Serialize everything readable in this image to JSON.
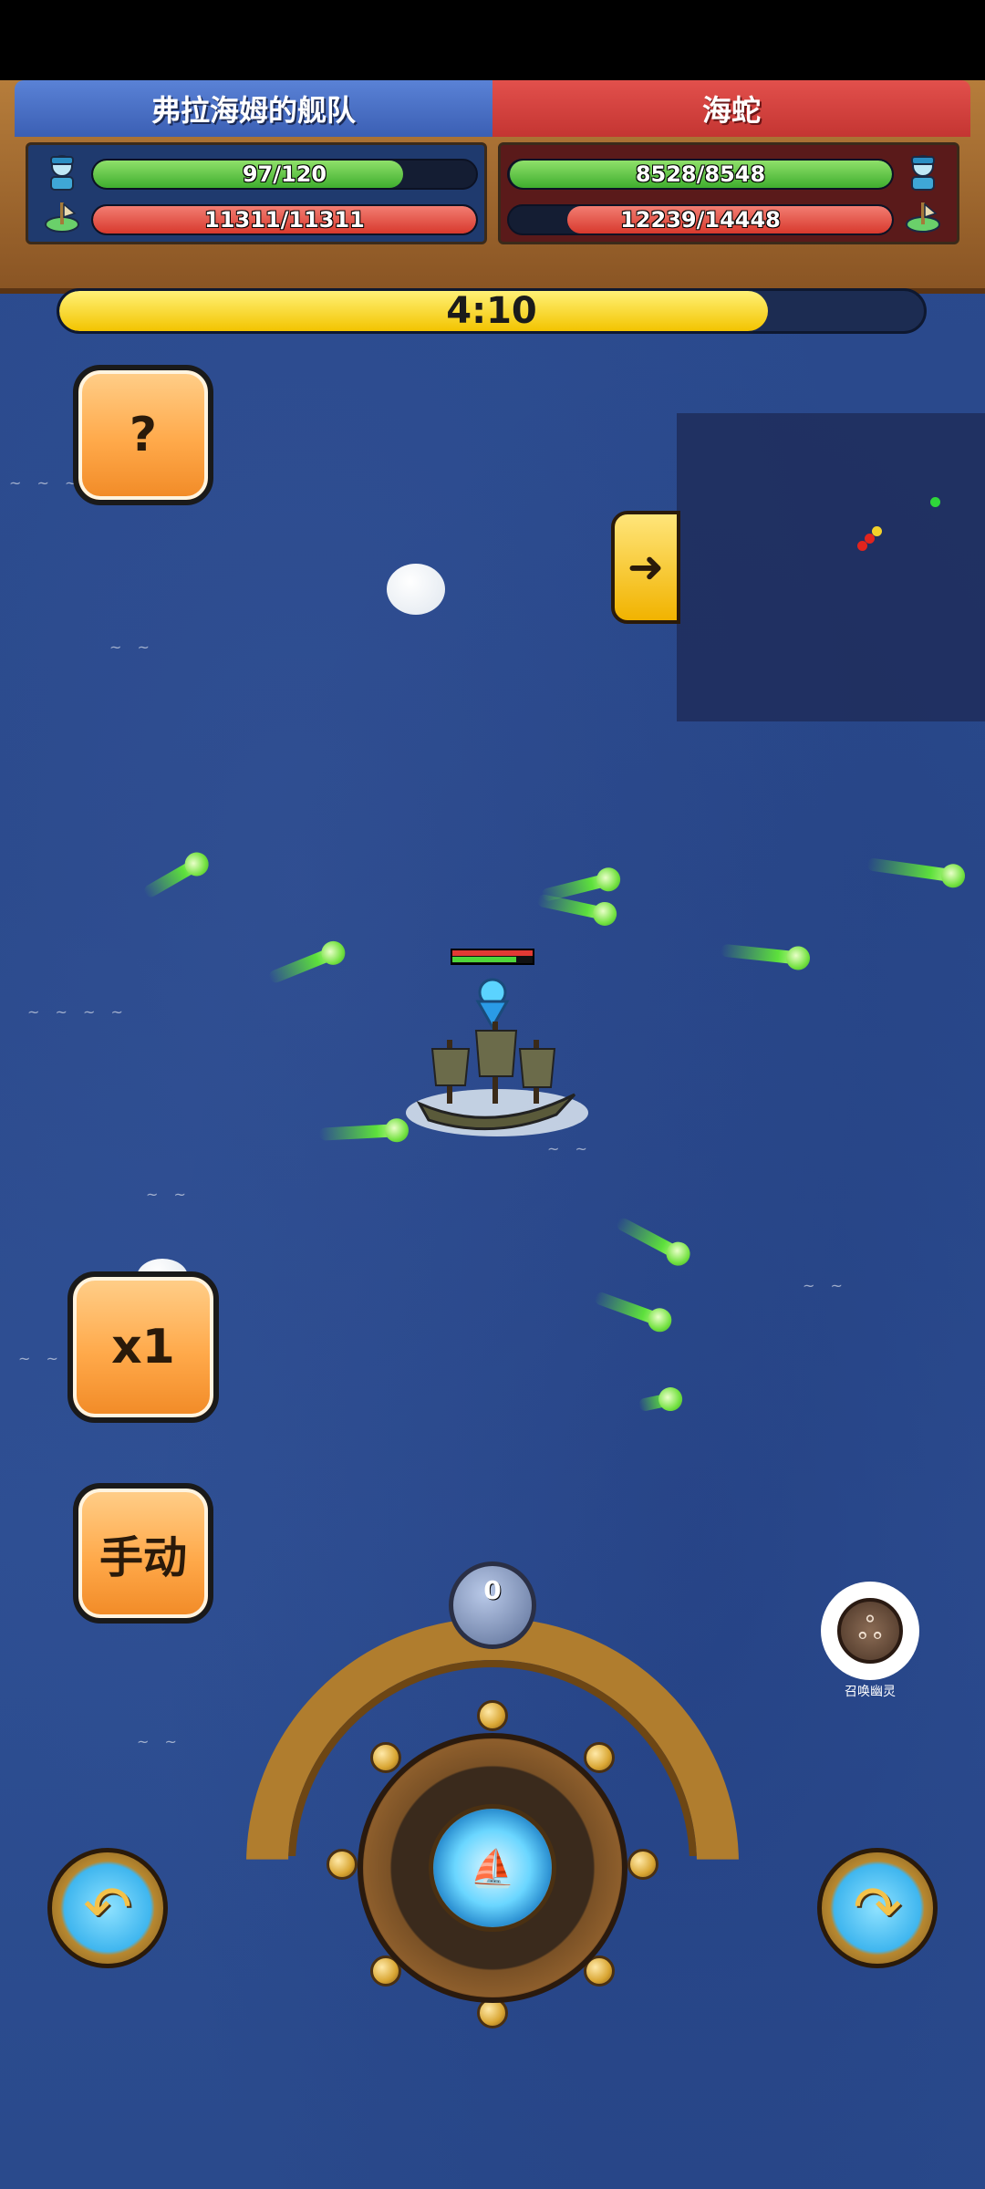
{
  "teams": {
    "left": {
      "name": "弗拉海姆的舰队",
      "crew": {
        "text": "97/120",
        "fraction": 0.81
      },
      "hull": {
        "text": "11311/11311",
        "fraction": 1.0
      }
    },
    "right": {
      "name": "海蛇",
      "crew": {
        "text": "8528/8548",
        "fraction": 0.998
      },
      "hull": {
        "text": "12239/14448",
        "fraction": 0.847
      }
    }
  },
  "timer": {
    "text": "4:10",
    "fraction": 0.82
  },
  "buttons": {
    "help": "?",
    "speed": "x1",
    "mode": "手动"
  },
  "gauge": {
    "value": "0"
  },
  "summon": {
    "label": "召唤幽灵"
  },
  "icons": {
    "expand": "arrow-right-icon",
    "turn_left": "turn-left-arrow-icon",
    "turn_right": "turn-right-arrow-icon"
  },
  "colors": {
    "left_team": "#4a70c6",
    "right_team": "#d8403c",
    "hp_green": "#5bc43a",
    "hp_red": "#e0473c",
    "timer_yellow": "#f6d21c",
    "sea": "#2b4a8d"
  }
}
